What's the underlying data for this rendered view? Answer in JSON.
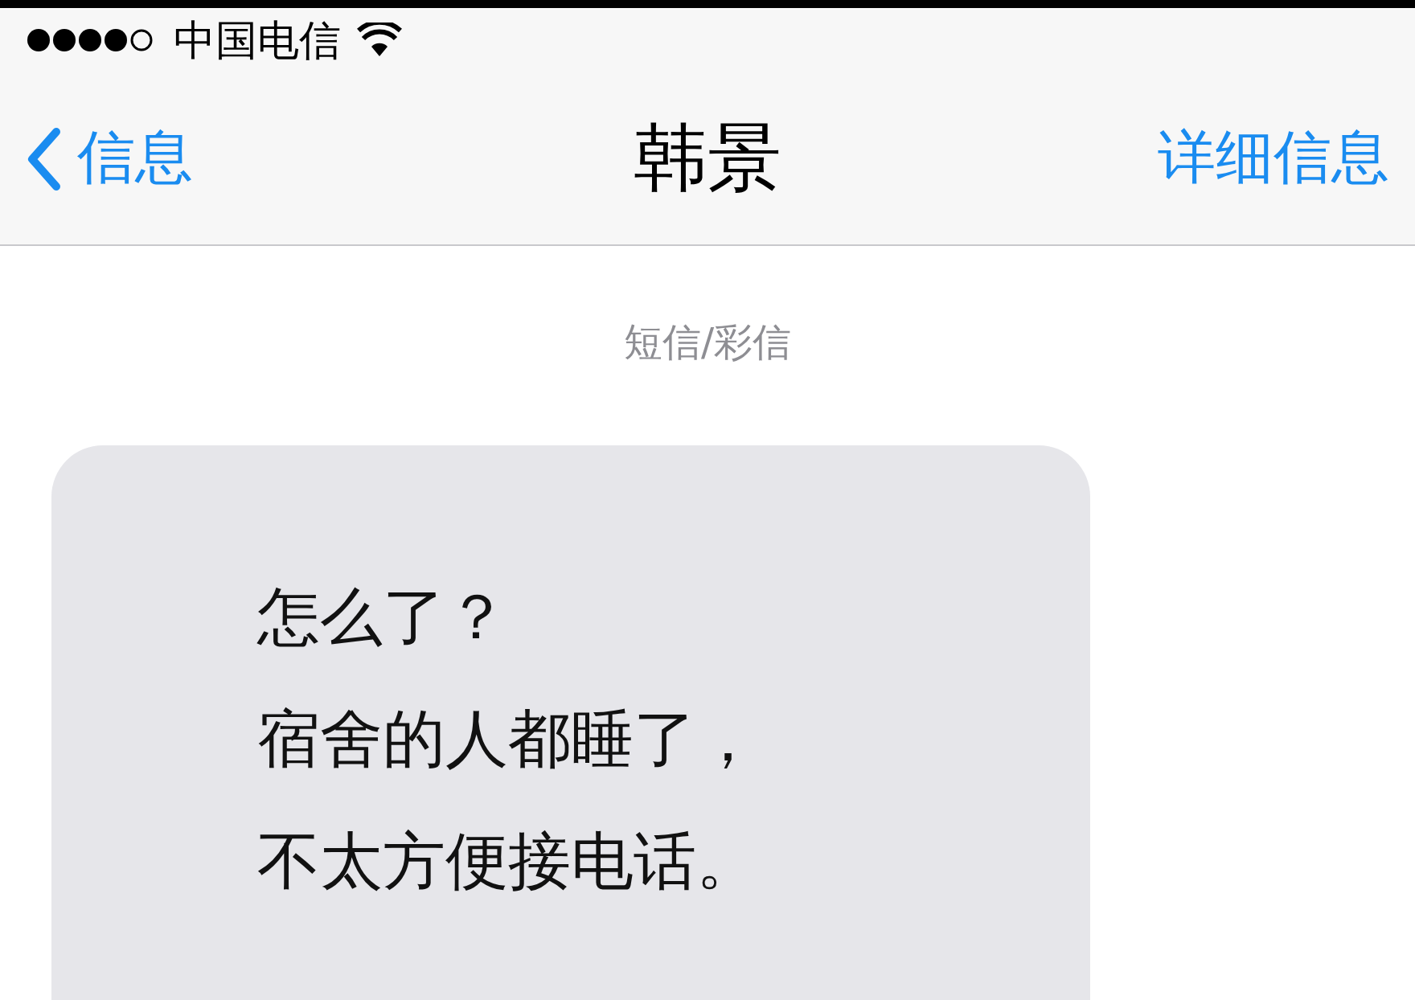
{
  "status_bar": {
    "carrier": "中国电信"
  },
  "nav": {
    "back": "信息",
    "title": "韩景",
    "action": "详细信息"
  },
  "thread": {
    "service": "短信/彩信",
    "messages": [
      {
        "kind": "received",
        "lines": [
          "怎么了？",
          "宿舍的人都睡了，",
          "不太方便接电话。"
        ]
      }
    ]
  }
}
